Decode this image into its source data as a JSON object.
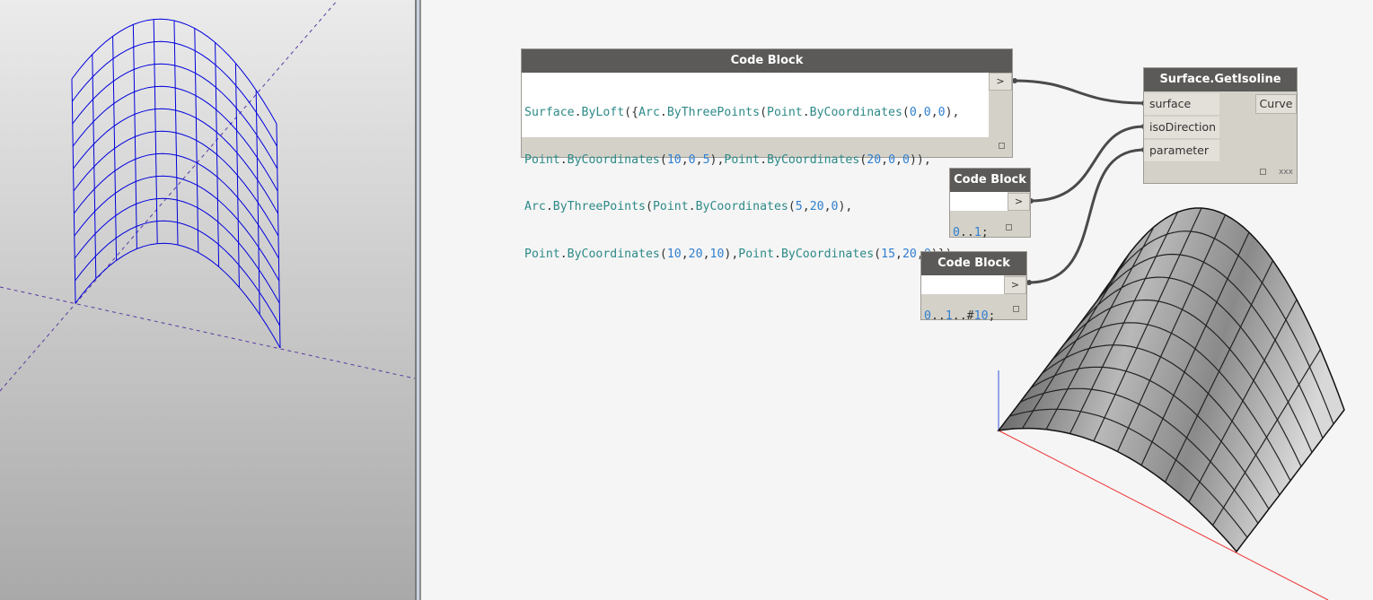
{
  "colors": {
    "node_title_bg": "#5b5a58",
    "node_body_bg": "#d4d1c9",
    "wire": "#4a4a4a",
    "wireframe": "#0000dd",
    "surface_edge": "#222222",
    "axis_x": "#ee3333",
    "axis_z": "#3355dd"
  },
  "nodes": {
    "code_block_surface": {
      "title": "Code Block",
      "out_arrow": ">",
      "line1": [
        "Surface",
        ".",
        "ByLoft",
        "({",
        "Arc",
        ".",
        "ByThreePoints",
        "(",
        "Point",
        ".",
        "ByCoordinates",
        "(",
        "0",
        ",",
        "0",
        ",",
        "0",
        "),"
      ],
      "line2": [
        "Point",
        ".",
        "ByCoordinates",
        "(",
        "10",
        ",",
        "0",
        ",",
        "5",
        "),",
        "Point",
        ".",
        "ByCoordinates",
        "(",
        "20",
        ",",
        "0",
        ",",
        "0",
        ")),"
      ],
      "line3": [
        "Arc",
        ".",
        "ByThreePoints",
        "(",
        "Point",
        ".",
        "ByCoordinates",
        "(",
        "5",
        ",",
        "20",
        ",",
        "0",
        "),"
      ],
      "line4": [
        "Point",
        ".",
        "ByCoordinates",
        "(",
        "10",
        ",",
        "20",
        ",",
        "10",
        "),",
        "Point",
        ".",
        "ByCoordinates",
        "(",
        "15",
        ",",
        "20",
        ",",
        "0",
        ")});"
      ]
    },
    "code_block_direction": {
      "title": "Code Block",
      "out_arrow": ">",
      "tokens": [
        "0",
        "..",
        "1",
        ";"
      ]
    },
    "code_block_range": {
      "title": "Code Block",
      "out_arrow": ">",
      "tokens": [
        "0",
        "..",
        "1",
        "..#",
        "10",
        ";"
      ]
    },
    "get_isoline": {
      "title": "Surface.GetIsoline",
      "inputs": [
        "surface",
        "isoDirection",
        "parameter"
      ],
      "output": "Curve",
      "lacing": "xxx"
    }
  }
}
